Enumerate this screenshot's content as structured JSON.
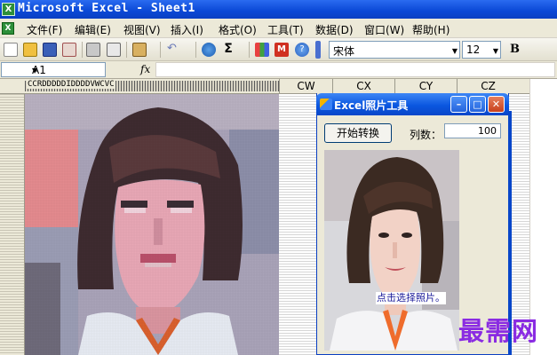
{
  "window": {
    "app_icon": "excel-icon",
    "title": "Microsoft Excel - Sheet1"
  },
  "menu": {
    "doc_icon": "workbook-icon",
    "items": [
      "文件(F)",
      "编辑(E)",
      "视图(V)",
      "插入(I)",
      "格式(O)",
      "工具(T)",
      "数据(D)",
      "窗口(W)",
      "帮助(H)"
    ]
  },
  "toolbar": {
    "font_name": "宋体",
    "font_size": "12",
    "bold_label": "B",
    "icons": [
      "new-icon",
      "open-icon",
      "save-icon",
      "permission-icon",
      "print-icon",
      "preview-icon",
      "paste-icon",
      "undo-icon",
      "hyperlink-icon",
      "autosum-icon",
      "chart-icon",
      "macro-icon",
      "help-icon"
    ],
    "sum_symbol": "Σ"
  },
  "formula_bar": {
    "name_box": "A1",
    "fx_label": "fx",
    "formula": ""
  },
  "sheet": {
    "crowded_header_text": "CCRDDDDDIDDDDVWCVC",
    "columns": [
      "CW",
      "CX",
      "CY",
      "CZ"
    ]
  },
  "dialog": {
    "title": "Excel照片工具",
    "start_button": "开始转换",
    "columns_label": "列数：",
    "columns_value": "100",
    "photo_hint": "点击选择照片。",
    "minimize_icon": "minimize-icon",
    "maximize_icon": "maximize-icon",
    "close_icon": "close-icon"
  },
  "watermark": "最需网",
  "colors": {
    "titlebar_blue": "#0a48d6",
    "excel_green": "#2d8f3a",
    "chrome": "#ece9d8",
    "watermark_purple": "#8a2be2"
  }
}
